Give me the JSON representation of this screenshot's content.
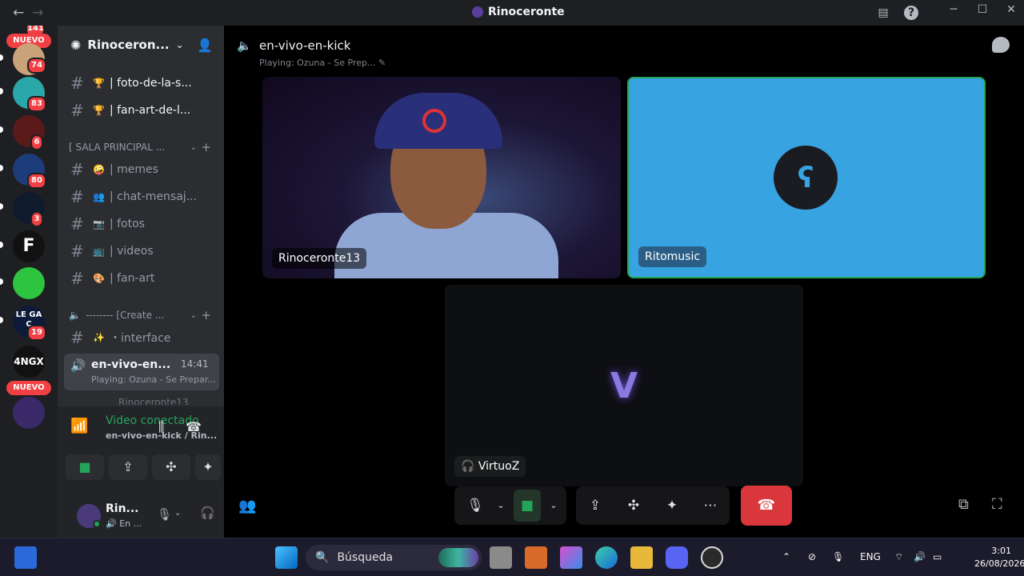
{
  "window": {
    "title": "Rinoceronte",
    "back_icon": "←",
    "forward_icon": "→"
  },
  "servers": {
    "badges": [
      "74",
      "83",
      "6",
      "80",
      "3",
      "19"
    ],
    "nuevo_label": "NUEVO",
    "top_badge": "141",
    "tile_4ngx": "4NGX",
    "tile_f": "F",
    "tile_lega": "LE GA C"
  },
  "sidebar": {
    "server_name": "Rinoceron...",
    "channels_top": [
      {
        "emoji": "🏆",
        "name": "| foto-de-la-s..."
      },
      {
        "emoji": "🏆",
        "name": "| fan-art-de-l..."
      }
    ],
    "category1": "[ SALA PRINCIPAL ...",
    "channels_main": [
      {
        "emoji": "🤪",
        "name": "| memes"
      },
      {
        "emoji": "👥",
        "name": "| chat-mensaj..."
      },
      {
        "emoji": "📷",
        "name": "| fotos"
      },
      {
        "emoji": "📺",
        "name": "| videos"
      },
      {
        "emoji": "🎨",
        "name": "| fan-art"
      }
    ],
    "category2": "-------- [Create ...",
    "interface_channel": {
      "emoji": "✨",
      "name": "・interface"
    },
    "active_voice": {
      "name": "en-vivo-en...",
      "time": "14:41",
      "status": "Playing: Ozuna - Se Prepar..."
    },
    "voice_member": "Rinoceronte13"
  },
  "voice_panel": {
    "title": "Video conectado",
    "subtitle": "en-vivo-en-kick / Rin..."
  },
  "user_panel": {
    "name": "Rin...",
    "status": "En ..."
  },
  "main": {
    "channel_title": "en-vivo-en-kick",
    "channel_status": "Playing: Ozuna - Se Prep...",
    "participants": [
      {
        "name": "Rinoceronte13"
      },
      {
        "name": "Ritomusic"
      },
      {
        "name": "VirtuoZ"
      }
    ]
  },
  "taskbar": {
    "search_placeholder": "Búsqueda",
    "lang": "ENG",
    "time": "3:01",
    "date": "26/08/2026"
  }
}
